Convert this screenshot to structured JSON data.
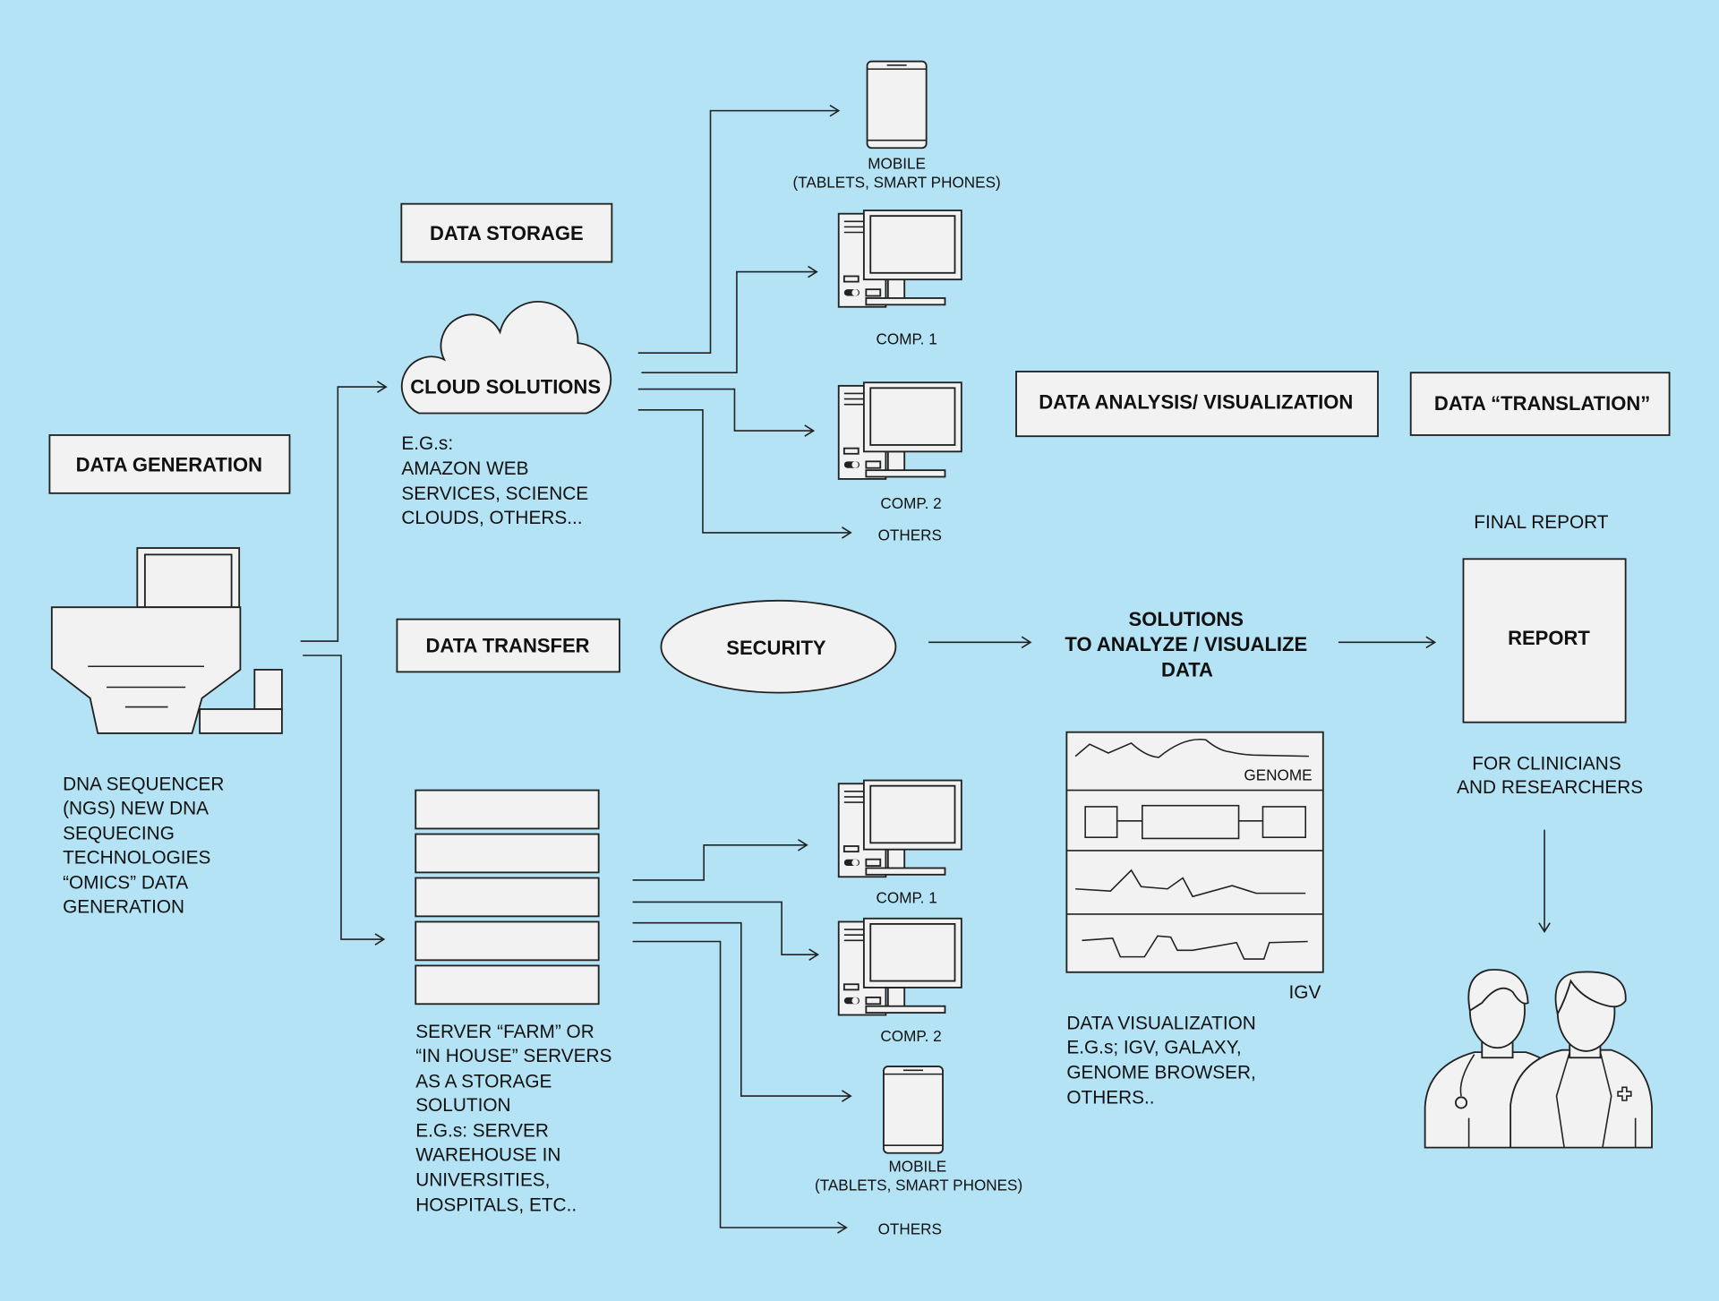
{
  "colors": {
    "background": "#b3e3f4",
    "shape_fill": "#f2f2f2",
    "stroke": "#222222"
  },
  "headings": {
    "data_storage": "DATA STORAGE",
    "data_generation": "DATA GENERATION",
    "data_transfer": "DATA TRANSFER",
    "data_analysis": "DATA ANALYSIS/ VISUALIZATION",
    "data_translation": "DATA “TRANSLATION”"
  },
  "cloud": {
    "label": "CLOUD SOLUTIONS",
    "description": [
      "E.G.s:",
      "AMAZON WEB",
      "SERVICES, SCIENCE",
      "CLOUDS, OTHERS..."
    ]
  },
  "security": {
    "label": "SECURITY"
  },
  "sequencer": {
    "description": [
      "DNA SEQUENCER",
      "(NGS) NEW DNA",
      "SEQUECING",
      "TECHNOLOGIES",
      "“OMICS” DATA",
      "GENERATION"
    ]
  },
  "servers": {
    "description": [
      "SERVER “FARM” OR",
      "“IN HOUSE” SERVERS",
      "AS A STORAGE",
      "SOLUTION",
      "E.G.s: SERVER",
      "WAREHOUSE IN",
      "UNIVERSITIES,",
      "HOSPITALS, ETC.."
    ]
  },
  "devices_top": {
    "mobile": [
      "MOBILE",
      "(TABLETS, SMART PHONES)"
    ],
    "comp1": "COMP. 1",
    "comp2": "COMP. 2",
    "others": "OTHERS"
  },
  "devices_bottom": {
    "comp1": "COMP. 1",
    "comp2": "COMP. 2",
    "mobile": [
      "MOBILE",
      "(TABLETS, SMART PHONES)"
    ],
    "others": "OTHERS"
  },
  "solutions": {
    "lines": [
      "SOLUTIONS",
      "TO  ANALYZE / VISUALIZE",
      "DATA"
    ]
  },
  "igv": {
    "genome_label": "GENOME",
    "caption": "IGV",
    "description": [
      "DATA VISUALIZATION",
      "E.G.s; IGV, GALAXY,",
      "GENOME BROWSER,",
      "OTHERS.."
    ]
  },
  "report": {
    "title": "FINAL REPORT",
    "label": "REPORT",
    "audience": [
      "FOR CLINICIANS",
      "AND RESEARCHERS"
    ]
  }
}
